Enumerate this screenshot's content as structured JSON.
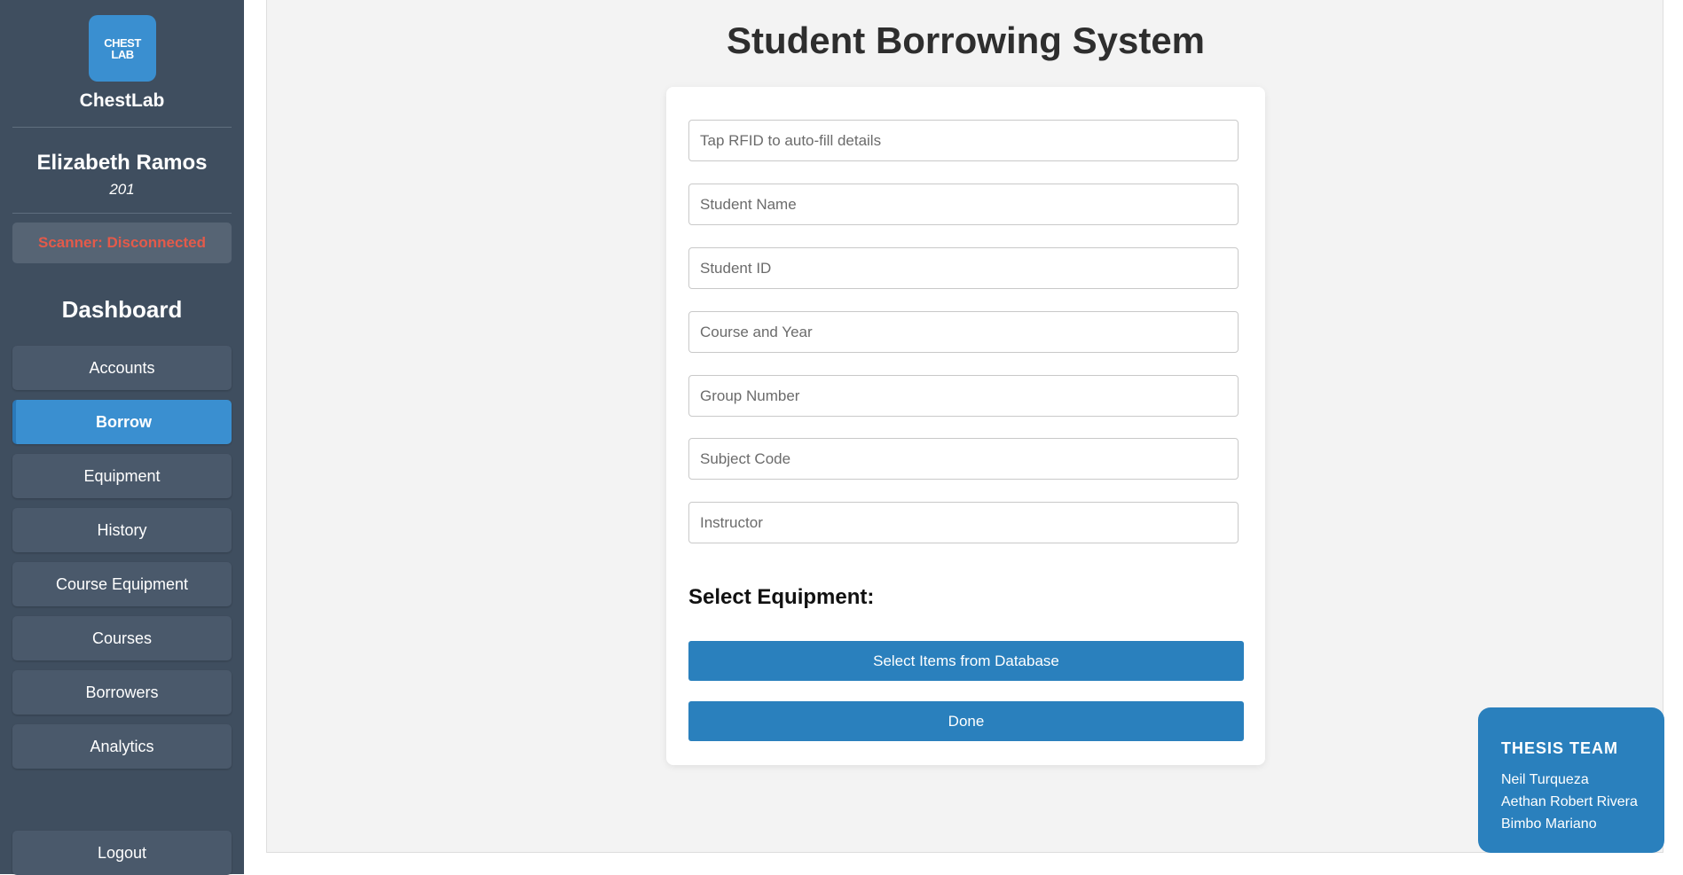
{
  "sidebar": {
    "logo_line1": "CHEST",
    "logo_line2": "LAB",
    "app_name": "ChestLab",
    "user_name": "Elizabeth Ramos",
    "user_id": "201",
    "scanner_status": "Scanner: Disconnected",
    "section_title": "Dashboard",
    "nav": [
      {
        "label": "Accounts",
        "active": false
      },
      {
        "label": "Borrow",
        "active": true
      },
      {
        "label": "Equipment",
        "active": false
      },
      {
        "label": "History",
        "active": false
      },
      {
        "label": "Course Equipment",
        "active": false
      },
      {
        "label": "Courses",
        "active": false
      },
      {
        "label": "Borrowers",
        "active": false
      },
      {
        "label": "Analytics",
        "active": false
      }
    ],
    "logout_label": "Logout"
  },
  "main": {
    "title": "Student Borrowing System",
    "fields": [
      {
        "placeholder": "Tap RFID to auto-fill details",
        "value": ""
      },
      {
        "placeholder": "Student Name",
        "value": ""
      },
      {
        "placeholder": "Student ID",
        "value": ""
      },
      {
        "placeholder": "Course and Year",
        "value": ""
      },
      {
        "placeholder": "Group Number",
        "value": ""
      },
      {
        "placeholder": "Subject Code",
        "value": ""
      },
      {
        "placeholder": "Instructor",
        "value": ""
      }
    ],
    "select_equipment_label": "Select Equipment:",
    "select_items_button": "Select Items from Database",
    "done_button": "Done"
  },
  "thesis_team": {
    "title": "THESIS TEAM",
    "members": [
      "Neil Turqueza",
      "Aethan Robert Rivera",
      "Bimbo Mariano"
    ]
  },
  "colors": {
    "sidebar_bg": "#3f4e5f",
    "accent": "#2a80bd",
    "scanner_text": "#e45a4a"
  }
}
